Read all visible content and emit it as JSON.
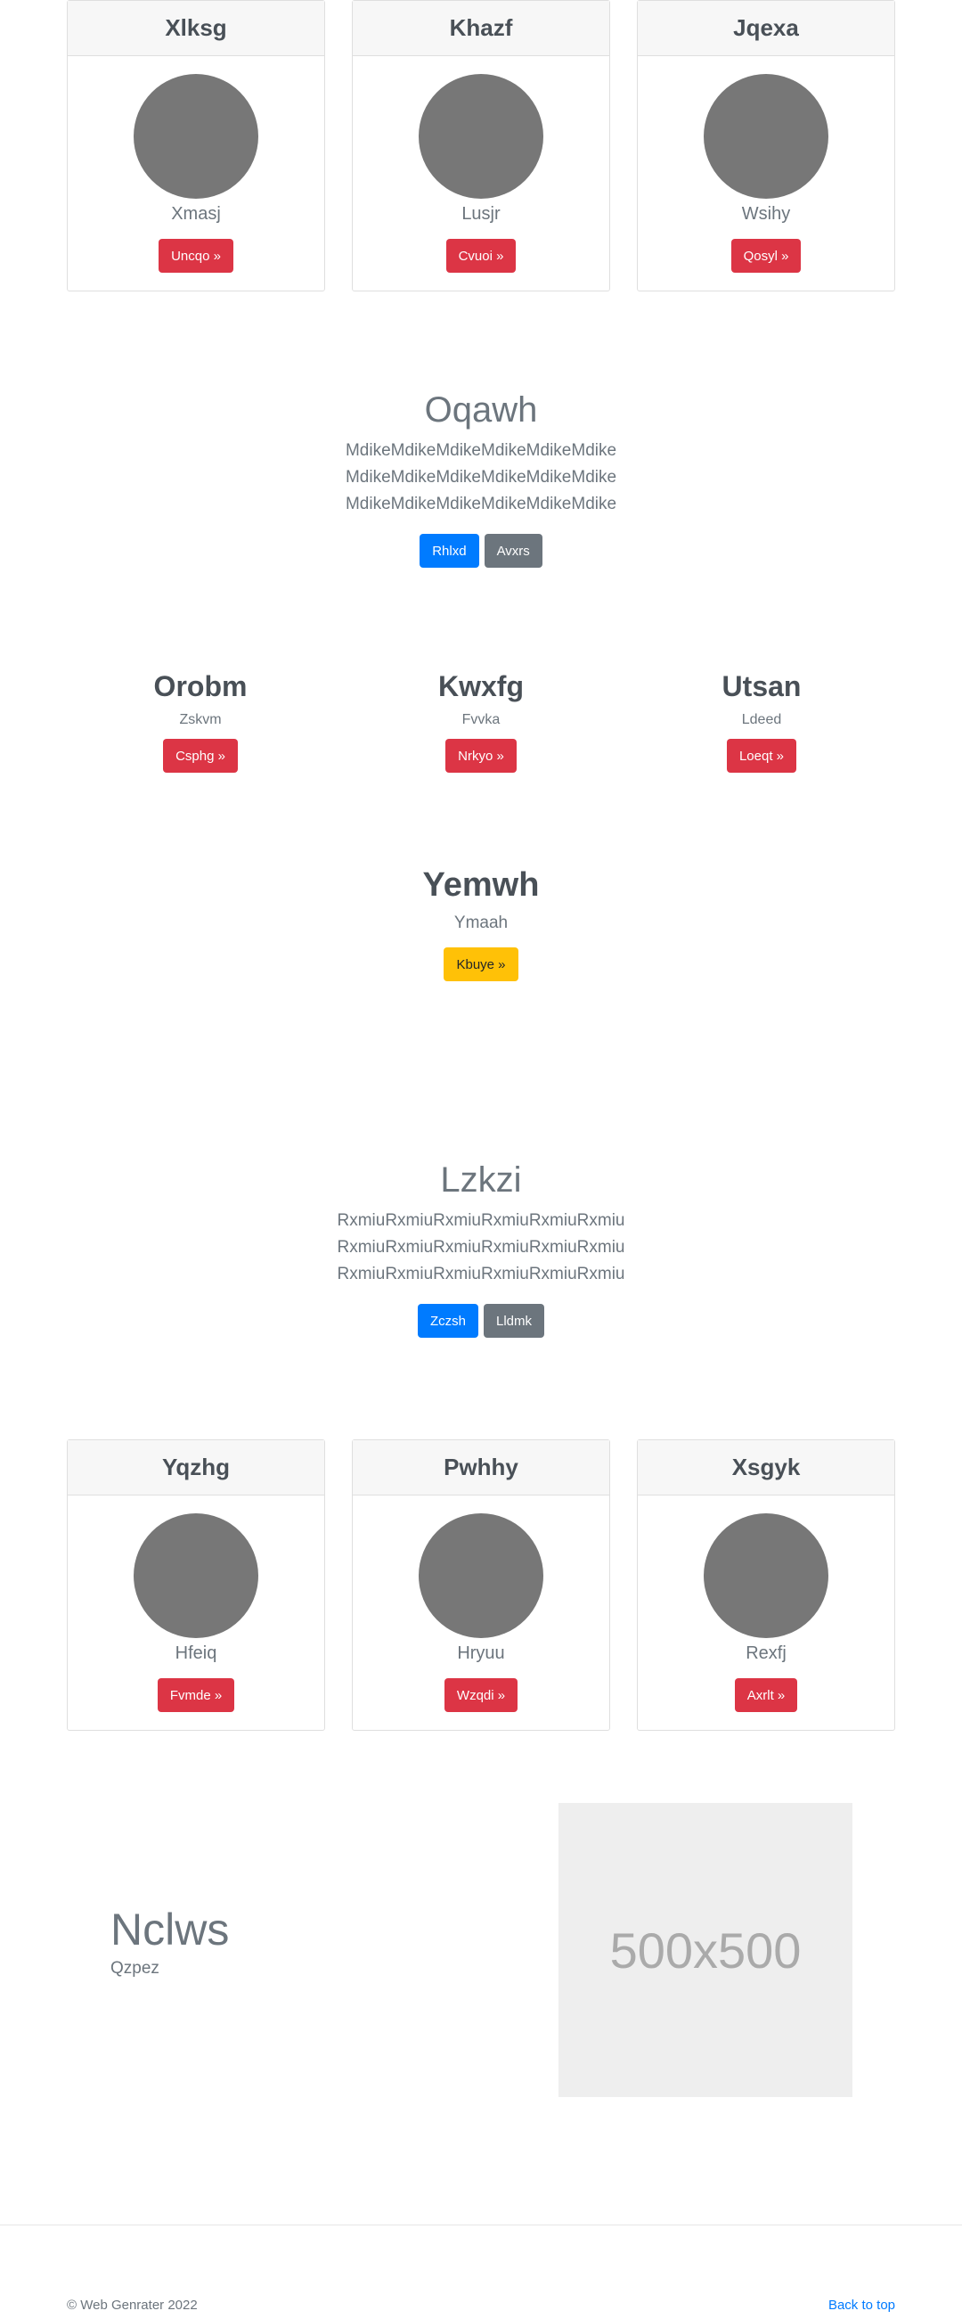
{
  "cards_top": [
    {
      "title": "Xlksg",
      "subtitle": "Xmasj",
      "button": "Uncqo »"
    },
    {
      "title": "Khazf",
      "subtitle": "Lusjr",
      "button": "Cvuoi »"
    },
    {
      "title": "Jqexa",
      "subtitle": "Wsihy",
      "button": "Qosyl »"
    }
  ],
  "hero1": {
    "title": "Oqawh",
    "lines": [
      "MdikeMdikeMdikeMdikeMdikeMdike",
      "MdikeMdikeMdikeMdikeMdikeMdike",
      "MdikeMdikeMdikeMdikeMdikeMdike"
    ],
    "primary_btn": "Rhlxd",
    "secondary_btn": "Avxrs"
  },
  "features": [
    {
      "title": "Orobm",
      "subtitle": "Zskvm",
      "button": "Csphg »"
    },
    {
      "title": "Kwxfg",
      "subtitle": "Fvvka",
      "button": "Nrkyo »"
    },
    {
      "title": "Utsan",
      "subtitle": "Ldeed",
      "button": "Loeqt »"
    }
  ],
  "cta": {
    "title": "Yemwh",
    "subtitle": "Ymaah",
    "button": "Kbuye »"
  },
  "hero2": {
    "title": "Lzkzi",
    "lines": [
      "RxmiuRxmiuRxmiuRxmiuRxmiuRxmiu",
      "RxmiuRxmiuRxmiuRxmiuRxmiuRxmiu",
      "RxmiuRxmiuRxmiuRxmiuRxmiuRxmiu"
    ],
    "primary_btn": "Zczsh",
    "secondary_btn": "Lldmk"
  },
  "cards_bottom": [
    {
      "title": "Yqzhg",
      "subtitle": "Hfeiq",
      "button": "Fvmde »"
    },
    {
      "title": "Pwhhy",
      "subtitle": "Hryuu",
      "button": "Wzqdi »"
    },
    {
      "title": "Xsgyk",
      "subtitle": "Rexfj",
      "button": "Axrlt »"
    }
  ],
  "split": {
    "title": "Nclws",
    "subtitle": "Qzpez",
    "image_label": "500x500"
  },
  "footer": {
    "copyright": "© Web Genrater 2022",
    "back_to_top": "Back to top"
  }
}
